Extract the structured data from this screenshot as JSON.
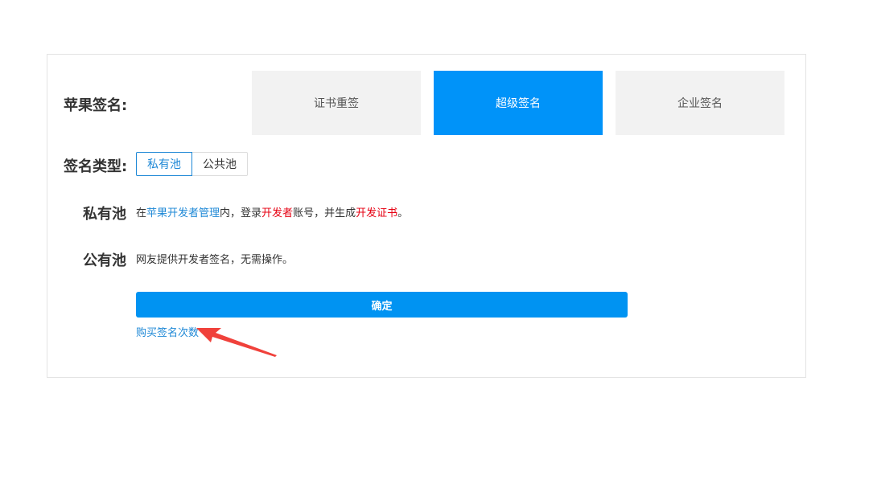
{
  "apple_signature": {
    "label": "苹果签名:",
    "options": [
      {
        "label": "证书重签",
        "active": false
      },
      {
        "label": "超级签名",
        "active": true
      },
      {
        "label": "企业签名",
        "active": false
      }
    ]
  },
  "signature_type": {
    "label": "签名类型:",
    "options": [
      {
        "label": "私有池",
        "active": true
      },
      {
        "label": "公共池",
        "active": false
      }
    ]
  },
  "private_pool": {
    "title": "私有池",
    "desc_part1": "在",
    "desc_link1": "苹果开发者管理",
    "desc_part2": "内，登录",
    "desc_red1": "开发者",
    "desc_part3": "账号，并生成",
    "desc_red2": "开发证书",
    "desc_part4": "。"
  },
  "public_pool": {
    "title": "公有池",
    "desc": "网友提供开发者签名，无需操作。"
  },
  "confirm_label": "确定",
  "buy_link_label": "购买签名次数",
  "colors": {
    "accent": "#0093f9",
    "link": "#1e88d6",
    "highlight_red": "#e60012",
    "annotation_arrow": "#f0413b"
  }
}
